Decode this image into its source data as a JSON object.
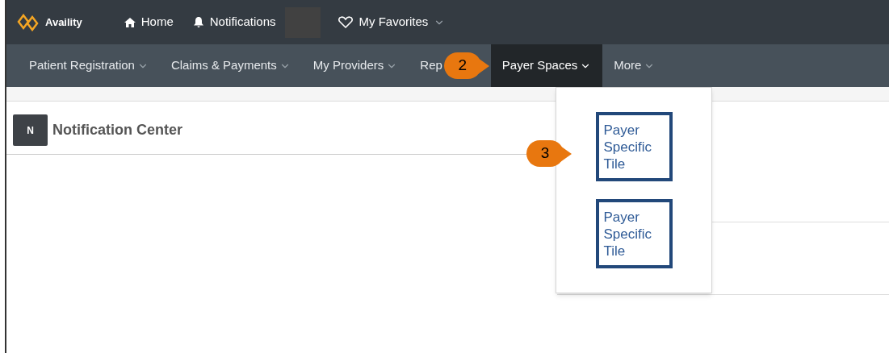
{
  "top_bar": {
    "logo": "Availity",
    "items": [
      {
        "kind": "home",
        "label": "Home"
      },
      {
        "kind": "bell",
        "label": "Notifications"
      },
      {
        "kind": "heart",
        "label": "My Favorites"
      }
    ]
  },
  "main_nav": [
    {
      "label": "Patient Registration",
      "selected": false
    },
    {
      "label": "Claims & Payments",
      "selected": false
    },
    {
      "label": "My Providers",
      "selected": false
    },
    {
      "label": "Rep",
      "selected": false
    },
    {
      "label": "Payer Spaces",
      "selected": true
    },
    {
      "label": "More",
      "selected": false
    }
  ],
  "dropdown": {
    "tiles": [
      "Payer\nSpecific\nTile",
      "Payer\nSpecific\nTile"
    ]
  },
  "panel": {
    "badge": "N",
    "title": "Notification Center"
  },
  "callouts": [
    "2",
    "3"
  ]
}
